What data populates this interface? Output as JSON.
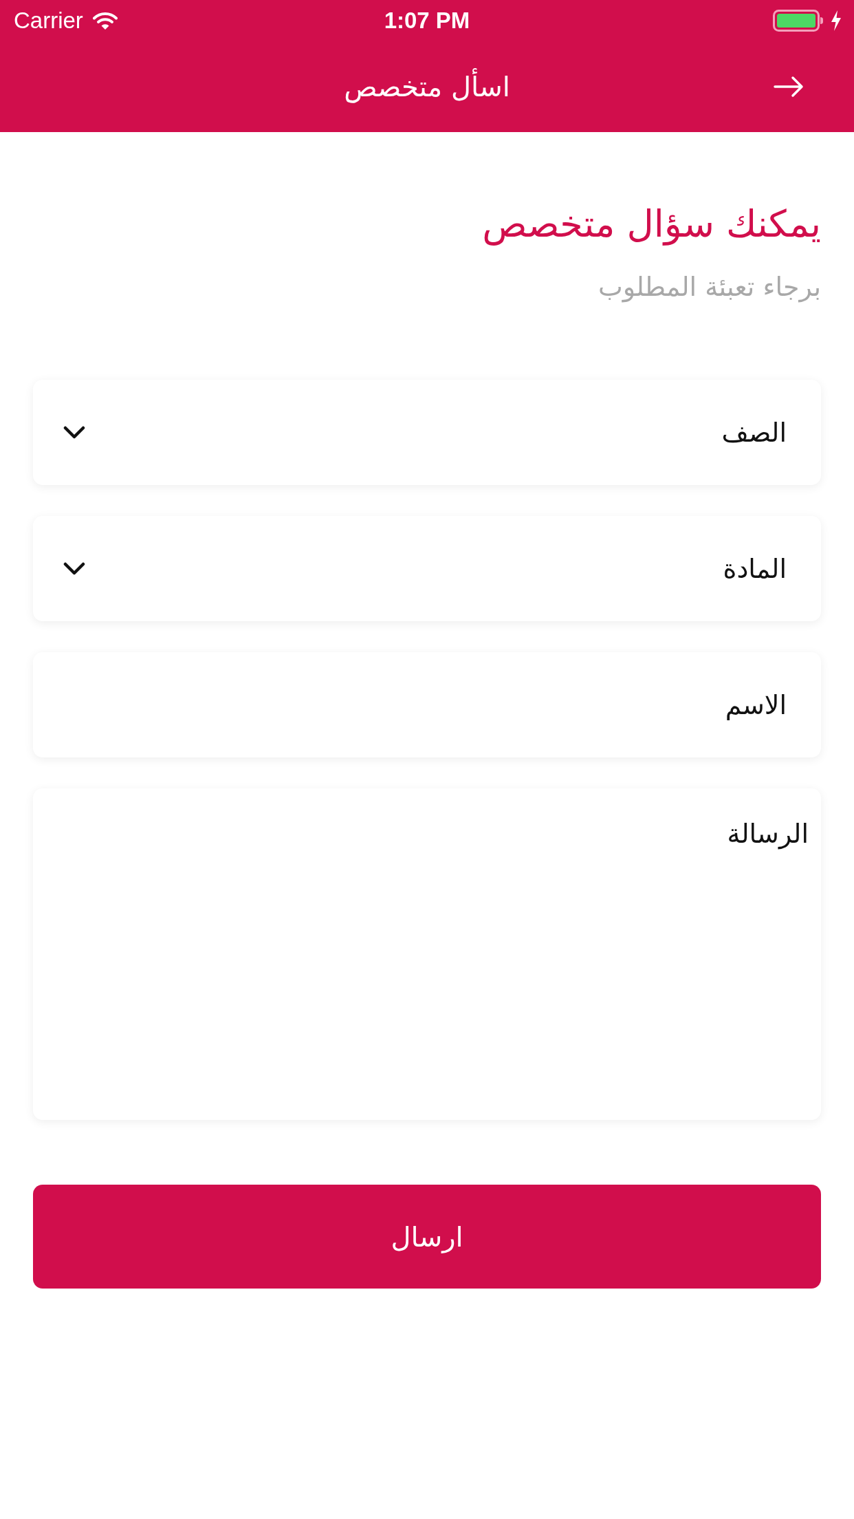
{
  "status_bar": {
    "carrier": "Carrier",
    "time": "1:07 PM"
  },
  "nav_bar": {
    "title": "اسأل متخصص"
  },
  "intro": {
    "heading": "يمكنك سؤال متخصص",
    "subheading": "برجاء تعبئة المطلوب"
  },
  "fields": [
    {
      "kind": "dropdown",
      "placeholder": "الصف"
    },
    {
      "kind": "dropdown",
      "placeholder": "المادة"
    },
    {
      "kind": "text",
      "placeholder": "الاسم"
    },
    {
      "kind": "textarea",
      "placeholder": "الرسالة"
    }
  ],
  "submit_button": {
    "label": "ارسال"
  }
}
